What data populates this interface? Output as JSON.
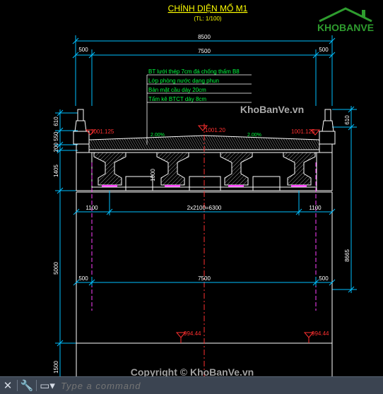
{
  "drawing": {
    "title": "CHÍNH DIỆN MỐ M1",
    "scale": "(TL: 1/100)",
    "dim_total": "8500",
    "dim_side_left": "500",
    "dim_middle": "7500",
    "dim_side_right": "500",
    "notes": [
      "BT lưới thép 7cm đá chống thấm B8",
      "Lớp phòng nước dạng phun",
      "Bản mặt cầu dày 20cm",
      "Tấm kê BTCT dày 8cm"
    ],
    "level_left": "1001.125",
    "level_center": "1001.20",
    "level_right": "1001.125",
    "slope_left": "2.00%",
    "slope_right": "2.00%",
    "dim_610_left": "610",
    "dim_610_right": "610",
    "dim_200_550": "200 550",
    "dim_1405": "1405",
    "dim_1000": "1000",
    "dim_1100_left": "1100",
    "dim_spacing": "2x2100=6300",
    "dim_1100_right": "1100",
    "dim_5000": "5000",
    "dim_8665": "8665",
    "dim_500_lower_left": "500",
    "dim_7500_lower": "7500",
    "dim_500_lower_right": "500",
    "dim_1500": "1500",
    "level_foot_left": "994.44",
    "level_foot_right": "994.44"
  },
  "watermarks": {
    "logo_text": "KHOBANVE",
    "site": "KhoBanVe.vn",
    "copyright": "Copyright © KhoBanVe.vn"
  },
  "command_bar": {
    "placeholder": "Type a command"
  },
  "colors": {
    "background": "#000000",
    "title": "#ffff00",
    "dimension": "#00bfff",
    "structure": "#ffffff",
    "note": "#00ff40",
    "level": "#ff3030",
    "axis": "#ff40ff",
    "logo": "#2e9c2e"
  }
}
